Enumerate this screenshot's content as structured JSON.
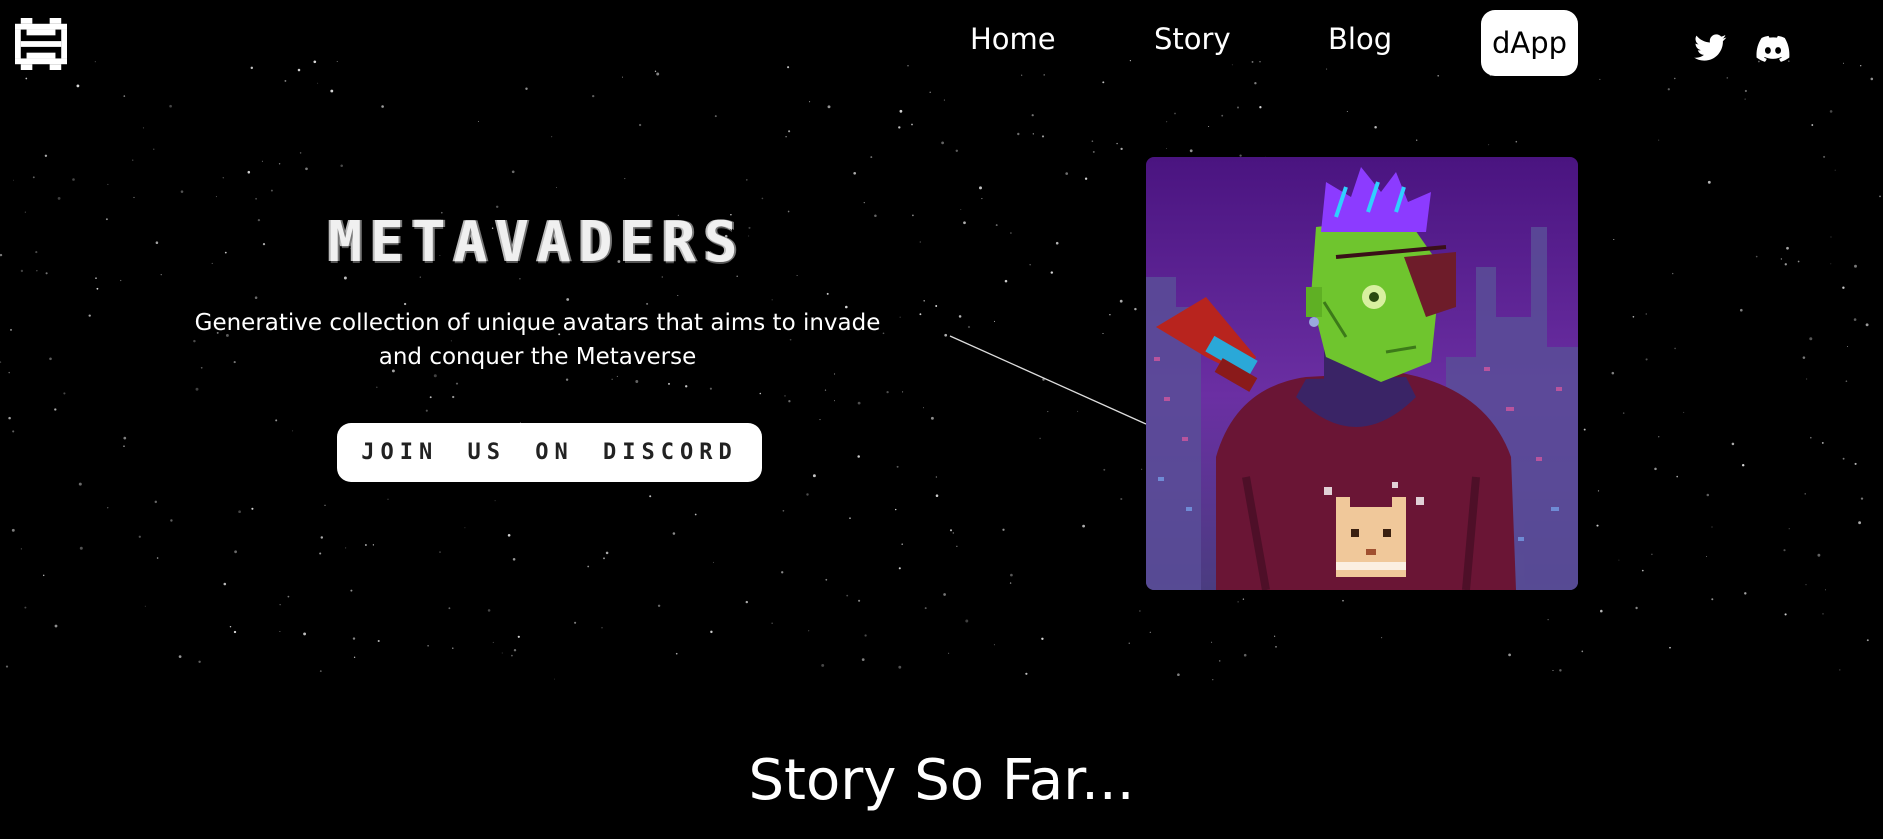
{
  "nav": {
    "logo_icon": "pixel-invader-logo",
    "home_label": "Home",
    "story_label": "Story",
    "blog_label": "Blog",
    "dapp_label": "dApp",
    "social": [
      "twitter-icon",
      "discord-icon"
    ]
  },
  "hero": {
    "title": "METAVADERS",
    "subtitle": "Generative collection of unique avatars that aims to invade and conquer the Metaverse",
    "cta_label": "JOIN US ON DISCORD",
    "art_icon": "pixel-avatar-artwork"
  },
  "section": {
    "title": "Story So Far..."
  },
  "colors": {
    "background": "#000000",
    "text": "#ffffff",
    "button_bg": "#ffffff",
    "art_purple": "#5a1a8c",
    "avatar_skin": "#6fc52e",
    "hoodie": "#6a1535",
    "hair": "#8c3bff"
  }
}
